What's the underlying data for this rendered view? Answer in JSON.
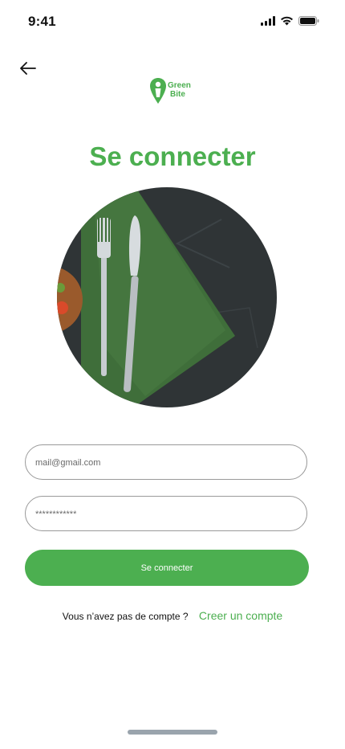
{
  "status_bar": {
    "time": "9:41"
  },
  "logo": {
    "line1": "Green",
    "line2": "Bite"
  },
  "page_title": "Se connecter",
  "form": {
    "email_placeholder": "mail@gmail.com",
    "email_value": "",
    "password_placeholder": "************",
    "password_value": "",
    "submit_label": "Se connecter"
  },
  "signup": {
    "prompt": "Vous n’avez pas de compte ?",
    "link_label": "Creer un compte"
  },
  "colors": {
    "accent": "#4caf50",
    "napkin": "#3f6e3a",
    "slate": "#2f3436"
  },
  "icons": {
    "back": "arrow-left-icon",
    "logo": "location-pin-person-icon"
  }
}
